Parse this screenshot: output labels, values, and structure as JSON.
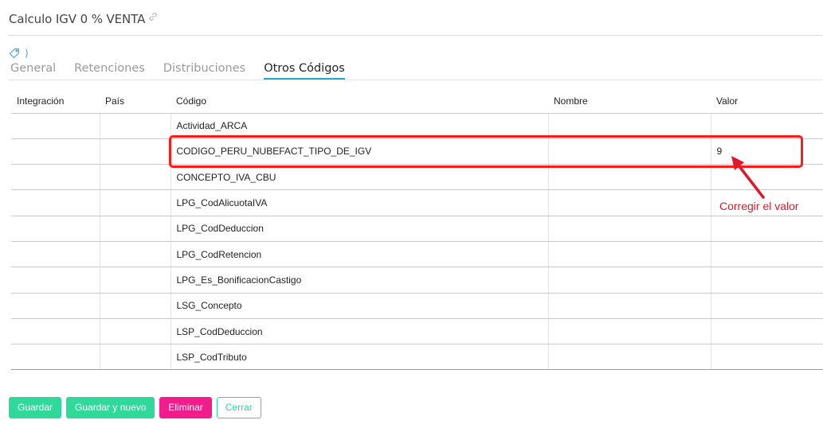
{
  "header": {
    "title": "Calculo IGV 0 % VENTA"
  },
  "tag_row": {
    "chevron": ")"
  },
  "tabs": [
    {
      "label": "General",
      "active": false
    },
    {
      "label": "Retenciones",
      "active": false
    },
    {
      "label": "Distribuciones",
      "active": false
    },
    {
      "label": "Otros Códigos",
      "active": true
    }
  ],
  "table": {
    "columns": [
      "Integración",
      "País",
      "Código",
      "Nombre",
      "Valor"
    ],
    "rows": [
      {
        "integracion": "",
        "pais": "",
        "codigo": "Actividad_ARCA",
        "nombre": "",
        "valor": ""
      },
      {
        "integracion": "",
        "pais": "",
        "codigo": "CODIGO_PERU_NUBEFACT_TIPO_DE_IGV",
        "nombre": "",
        "valor": "9"
      },
      {
        "integracion": "",
        "pais": "",
        "codigo": "CONCEPTO_IVA_CBU",
        "nombre": "",
        "valor": ""
      },
      {
        "integracion": "",
        "pais": "",
        "codigo": "LPG_CodAlicuotaIVA",
        "nombre": "",
        "valor": ""
      },
      {
        "integracion": "",
        "pais": "",
        "codigo": "LPG_CodDeduccion",
        "nombre": "",
        "valor": ""
      },
      {
        "integracion": "",
        "pais": "",
        "codigo": "LPG_CodRetencion",
        "nombre": "",
        "valor": ""
      },
      {
        "integracion": "",
        "pais": "",
        "codigo": "LPG_Es_BonificacionCastigo",
        "nombre": "",
        "valor": ""
      },
      {
        "integracion": "",
        "pais": "",
        "codigo": "LSG_Concepto",
        "nombre": "",
        "valor": ""
      },
      {
        "integracion": "",
        "pais": "",
        "codigo": "LSP_CodDeduccion",
        "nombre": "",
        "valor": ""
      },
      {
        "integracion": "",
        "pais": "",
        "codigo": "LSP_CodTributo",
        "nombre": "",
        "valor": ""
      }
    ]
  },
  "annotation": {
    "text": "Corregir el valor",
    "color": "#e2162b"
  },
  "actions": {
    "save": "Guardar",
    "save_new": "Guardar y nuevo",
    "delete": "Eliminar",
    "close": "Cerrar"
  },
  "colors": {
    "accent": "#26a9c9",
    "success": "#2ed99a",
    "danger": "#f21c8c",
    "highlight": "#ff1a1a"
  }
}
